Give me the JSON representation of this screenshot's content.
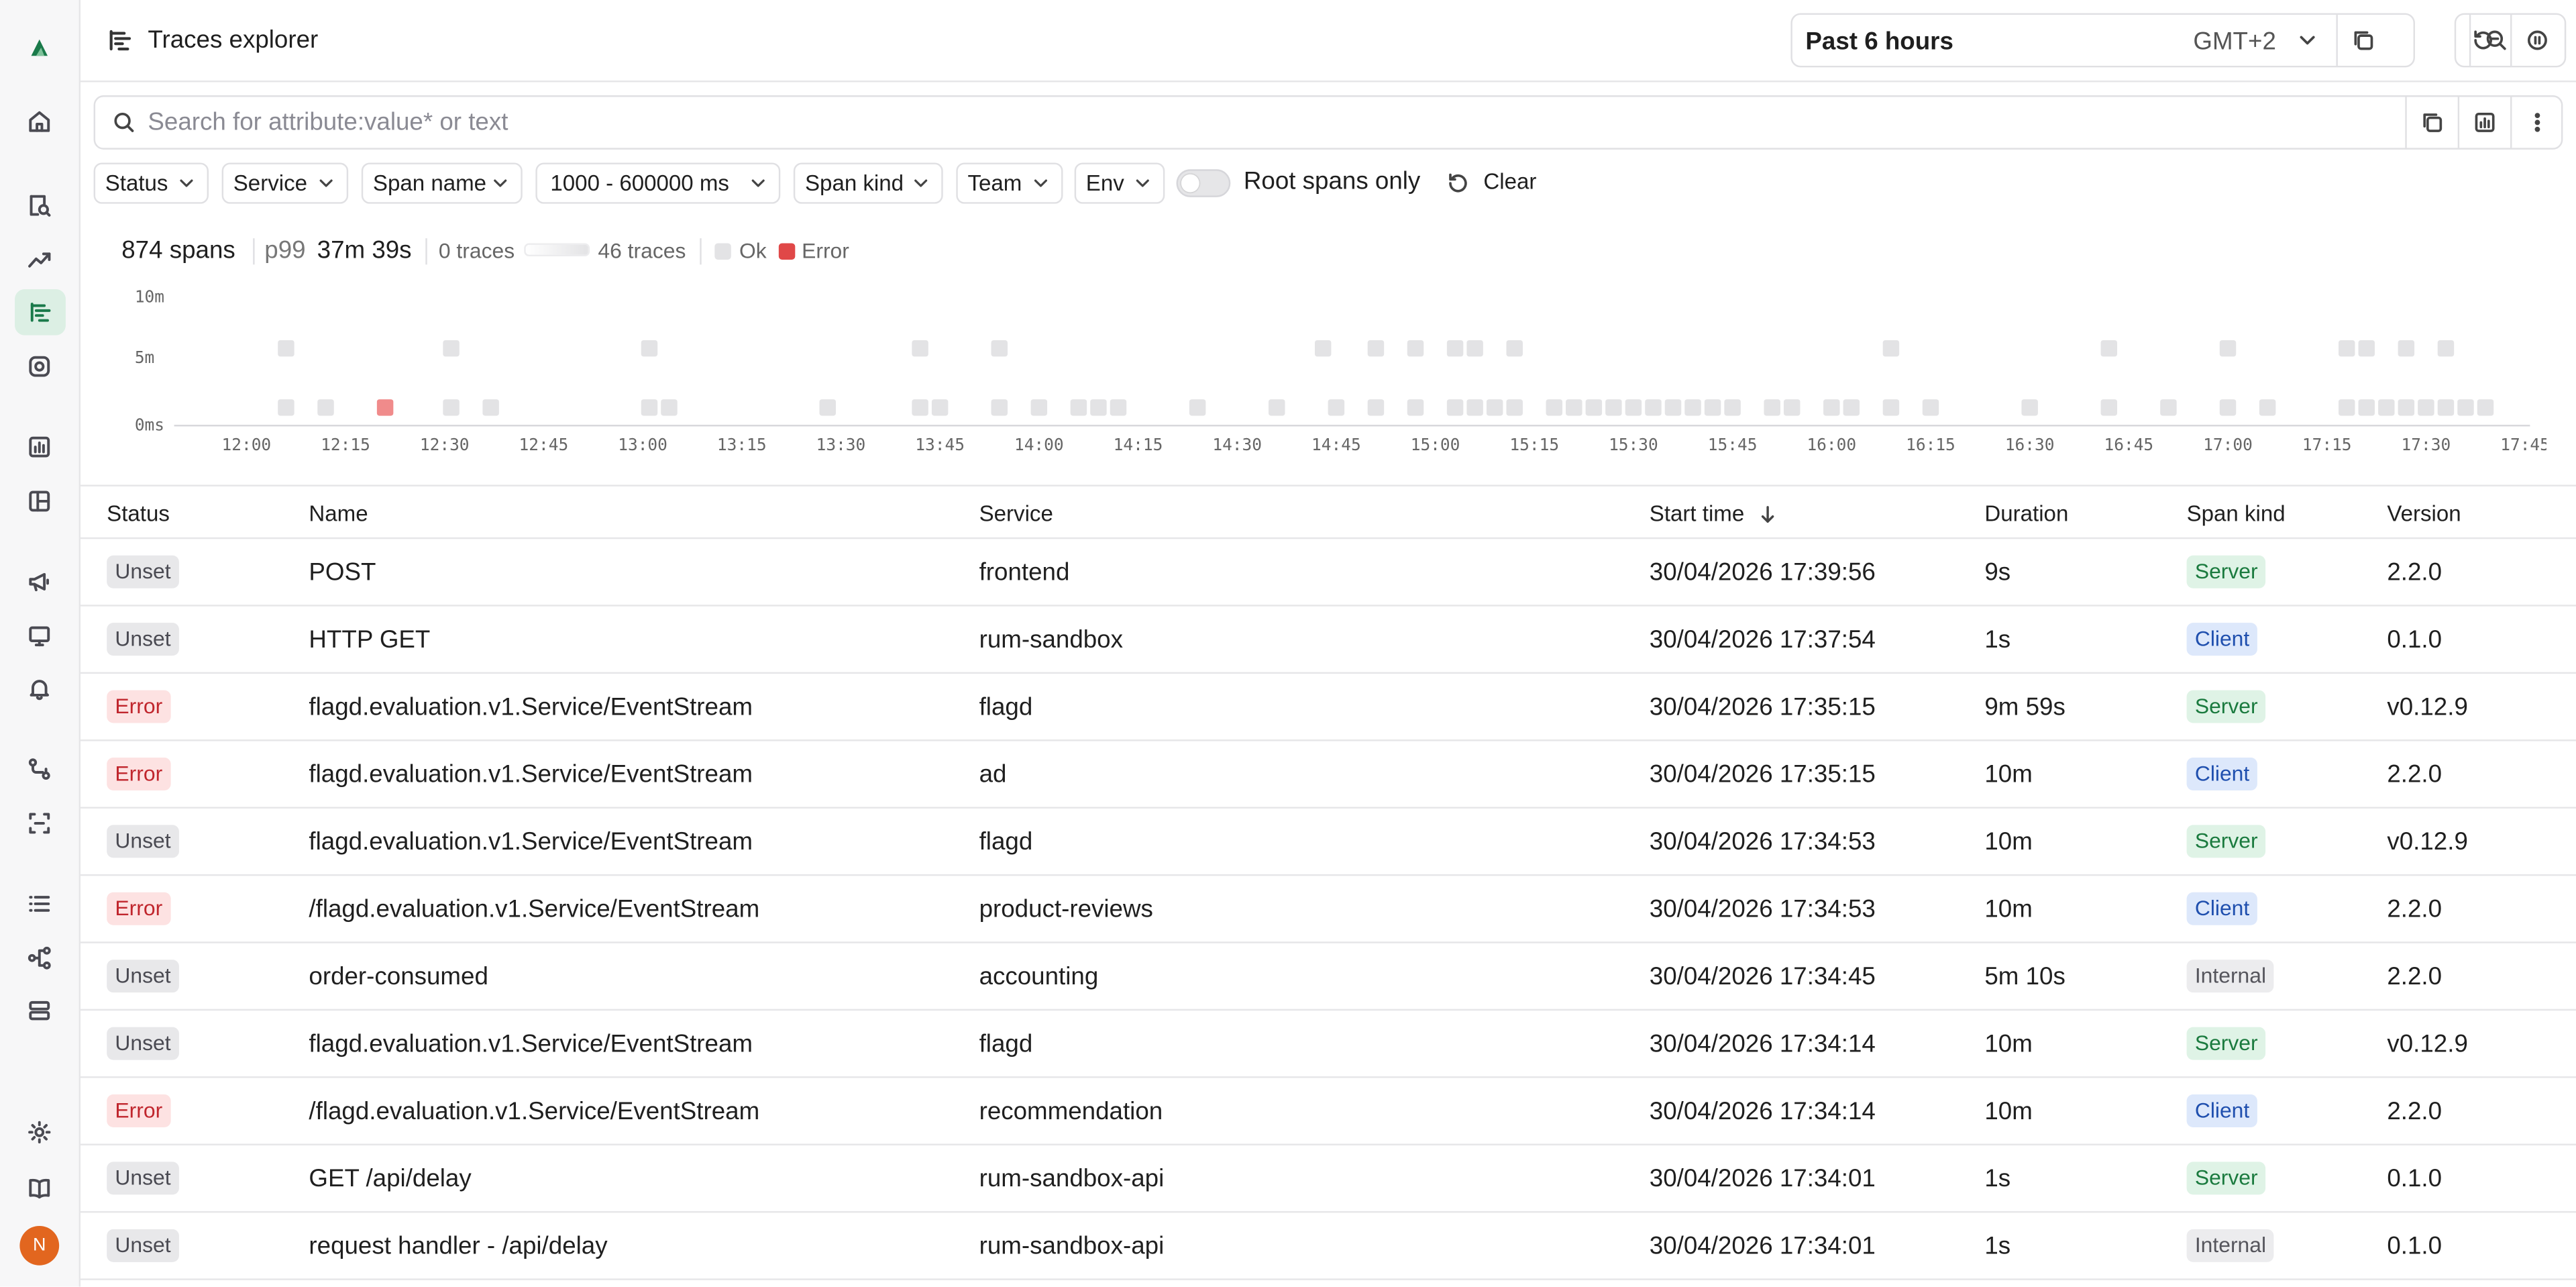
{
  "header": {
    "title": "Traces explorer",
    "time_range": "Past 6 hours",
    "timezone": "GMT+2"
  },
  "search": {
    "placeholder": "Search for attribute:value* or text"
  },
  "filters": [
    "Status",
    "Service",
    "Span name",
    "1000 - 600000 ms",
    "Span kind",
    "Team",
    "Env"
  ],
  "root_spans_only": {
    "label": "Root spans only",
    "enabled": false
  },
  "clear_label": "Clear",
  "stats": {
    "spans": "874 spans",
    "p99_label": "p99",
    "p99_value": "37m 39s",
    "min_traces": "0 traces",
    "max_traces": "46 traces",
    "legend_ok": "Ok",
    "legend_error": "Error"
  },
  "colors": {
    "ok": "#e3e3e5",
    "error": "#f08b8b",
    "accent": "#1a7a4a"
  },
  "chart_data": {
    "type": "heatmap",
    "y_ticks": [
      "10m",
      "5m",
      "0ms"
    ],
    "x_ticks": [
      "12:00",
      "12:15",
      "12:30",
      "12:45",
      "13:00",
      "13:15",
      "13:30",
      "13:45",
      "14:00",
      "14:15",
      "14:30",
      "14:45",
      "15:00",
      "15:15",
      "15:30",
      "15:45",
      "16:00",
      "16:15",
      "16:30",
      "16:45",
      "17:00",
      "17:15",
      "17:30",
      "17:45"
    ],
    "cells": [
      {
        "t": "12:06",
        "row": "5m",
        "status": "Ok"
      },
      {
        "t": "12:31",
        "row": "5m",
        "status": "Ok"
      },
      {
        "t": "13:01",
        "row": "5m",
        "status": "Ok"
      },
      {
        "t": "13:42",
        "row": "5m",
        "status": "Ok"
      },
      {
        "t": "13:54",
        "row": "5m",
        "status": "Ok"
      },
      {
        "t": "14:43",
        "row": "5m",
        "status": "Ok"
      },
      {
        "t": "14:51",
        "row": "5m",
        "status": "Ok"
      },
      {
        "t": "14:57",
        "row": "5m",
        "status": "Ok"
      },
      {
        "t": "15:03",
        "row": "5m",
        "status": "Ok"
      },
      {
        "t": "15:06",
        "row": "5m",
        "status": "Ok"
      },
      {
        "t": "15:12",
        "row": "5m",
        "status": "Ok"
      },
      {
        "t": "16:09",
        "row": "5m",
        "status": "Ok"
      },
      {
        "t": "16:42",
        "row": "5m",
        "status": "Ok"
      },
      {
        "t": "17:00",
        "row": "5m",
        "status": "Ok"
      },
      {
        "t": "17:18",
        "row": "5m",
        "status": "Ok"
      },
      {
        "t": "17:21",
        "row": "5m",
        "status": "Ok"
      },
      {
        "t": "17:27",
        "row": "5m",
        "status": "Ok"
      },
      {
        "t": "17:33",
        "row": "5m",
        "status": "Ok"
      },
      {
        "t": "12:06",
        "row": "0ms",
        "status": "Ok"
      },
      {
        "t": "12:12",
        "row": "0ms",
        "status": "Ok"
      },
      {
        "t": "12:21",
        "row": "0ms",
        "status": "Error"
      },
      {
        "t": "12:31",
        "row": "0ms",
        "status": "Ok"
      },
      {
        "t": "12:37",
        "row": "0ms",
        "status": "Ok"
      },
      {
        "t": "13:01",
        "row": "0ms",
        "status": "Ok"
      },
      {
        "t": "13:04",
        "row": "0ms",
        "status": "Ok"
      },
      {
        "t": "13:28",
        "row": "0ms",
        "status": "Ok"
      },
      {
        "t": "13:42",
        "row": "0ms",
        "status": "Ok"
      },
      {
        "t": "13:45",
        "row": "0ms",
        "status": "Ok"
      },
      {
        "t": "13:54",
        "row": "0ms",
        "status": "Ok"
      },
      {
        "t": "14:00",
        "row": "0ms",
        "status": "Ok"
      },
      {
        "t": "14:06",
        "row": "0ms",
        "status": "Ok"
      },
      {
        "t": "14:09",
        "row": "0ms",
        "status": "Ok"
      },
      {
        "t": "14:12",
        "row": "0ms",
        "status": "Ok"
      },
      {
        "t": "14:24",
        "row": "0ms",
        "status": "Ok"
      },
      {
        "t": "14:36",
        "row": "0ms",
        "status": "Ok"
      },
      {
        "t": "14:45",
        "row": "0ms",
        "status": "Ok"
      },
      {
        "t": "14:51",
        "row": "0ms",
        "status": "Ok"
      },
      {
        "t": "14:57",
        "row": "0ms",
        "status": "Ok"
      },
      {
        "t": "15:03",
        "row": "0ms",
        "status": "Ok"
      },
      {
        "t": "15:06",
        "row": "0ms",
        "status": "Ok"
      },
      {
        "t": "15:09",
        "row": "0ms",
        "status": "Ok"
      },
      {
        "t": "15:12",
        "row": "0ms",
        "status": "Ok"
      },
      {
        "t": "15:18",
        "row": "0ms",
        "status": "Ok"
      },
      {
        "t": "15:21",
        "row": "0ms",
        "status": "Ok"
      },
      {
        "t": "15:24",
        "row": "0ms",
        "status": "Ok"
      },
      {
        "t": "15:27",
        "row": "0ms",
        "status": "Ok"
      },
      {
        "t": "15:30",
        "row": "0ms",
        "status": "Ok"
      },
      {
        "t": "15:33",
        "row": "0ms",
        "status": "Ok"
      },
      {
        "t": "15:36",
        "row": "0ms",
        "status": "Ok"
      },
      {
        "t": "15:39",
        "row": "0ms",
        "status": "Ok"
      },
      {
        "t": "15:42",
        "row": "0ms",
        "status": "Ok"
      },
      {
        "t": "15:45",
        "row": "0ms",
        "status": "Ok"
      },
      {
        "t": "15:51",
        "row": "0ms",
        "status": "Ok"
      },
      {
        "t": "15:54",
        "row": "0ms",
        "status": "Ok"
      },
      {
        "t": "16:00",
        "row": "0ms",
        "status": "Ok"
      },
      {
        "t": "16:03",
        "row": "0ms",
        "status": "Ok"
      },
      {
        "t": "16:09",
        "row": "0ms",
        "status": "Ok"
      },
      {
        "t": "16:15",
        "row": "0ms",
        "status": "Ok"
      },
      {
        "t": "16:30",
        "row": "0ms",
        "status": "Ok"
      },
      {
        "t": "16:42",
        "row": "0ms",
        "status": "Ok"
      },
      {
        "t": "16:51",
        "row": "0ms",
        "status": "Ok"
      },
      {
        "t": "17:00",
        "row": "0ms",
        "status": "Ok"
      },
      {
        "t": "17:06",
        "row": "0ms",
        "status": "Ok"
      },
      {
        "t": "17:18",
        "row": "0ms",
        "status": "Ok"
      },
      {
        "t": "17:21",
        "row": "0ms",
        "status": "Ok"
      },
      {
        "t": "17:24",
        "row": "0ms",
        "status": "Ok"
      },
      {
        "t": "17:27",
        "row": "0ms",
        "status": "Ok"
      },
      {
        "t": "17:30",
        "row": "0ms",
        "status": "Ok"
      },
      {
        "t": "17:33",
        "row": "0ms",
        "status": "Ok"
      },
      {
        "t": "17:36",
        "row": "0ms",
        "status": "Ok"
      },
      {
        "t": "17:39",
        "row": "0ms",
        "status": "Ok"
      }
    ]
  },
  "table": {
    "columns": [
      "Status",
      "Name",
      "Service",
      "Start time",
      "Duration",
      "Span kind",
      "Version"
    ],
    "sort_column": "Start time",
    "sort_direction": "desc",
    "rows": [
      {
        "status": "Unset",
        "name": "POST",
        "service": "frontend",
        "start": "30/04/2026 17:39:56",
        "duration": "9s",
        "kind": "Server",
        "version": "2.2.0"
      },
      {
        "status": "Unset",
        "name": "HTTP GET",
        "service": "rum-sandbox",
        "start": "30/04/2026 17:37:54",
        "duration": "1s",
        "kind": "Client",
        "version": "0.1.0"
      },
      {
        "status": "Error",
        "name": "flagd.evaluation.v1.Service/EventStream",
        "service": "flagd",
        "start": "30/04/2026 17:35:15",
        "duration": "9m 59s",
        "kind": "Server",
        "version": "v0.12.9"
      },
      {
        "status": "Error",
        "name": "flagd.evaluation.v1.Service/EventStream",
        "service": "ad",
        "start": "30/04/2026 17:35:15",
        "duration": "10m",
        "kind": "Client",
        "version": "2.2.0"
      },
      {
        "status": "Unset",
        "name": "flagd.evaluation.v1.Service/EventStream",
        "service": "flagd",
        "start": "30/04/2026 17:34:53",
        "duration": "10m",
        "kind": "Server",
        "version": "v0.12.9"
      },
      {
        "status": "Error",
        "name": "/flagd.evaluation.v1.Service/EventStream",
        "service": "product-reviews",
        "start": "30/04/2026 17:34:53",
        "duration": "10m",
        "kind": "Client",
        "version": "2.2.0"
      },
      {
        "status": "Unset",
        "name": "order-consumed",
        "service": "accounting",
        "start": "30/04/2026 17:34:45",
        "duration": "5m 10s",
        "kind": "Internal",
        "version": "2.2.0"
      },
      {
        "status": "Unset",
        "name": "flagd.evaluation.v1.Service/EventStream",
        "service": "flagd",
        "start": "30/04/2026 17:34:14",
        "duration": "10m",
        "kind": "Server",
        "version": "v0.12.9"
      },
      {
        "status": "Error",
        "name": "/flagd.evaluation.v1.Service/EventStream",
        "service": "recommendation",
        "start": "30/04/2026 17:34:14",
        "duration": "10m",
        "kind": "Client",
        "version": "2.2.0"
      },
      {
        "status": "Unset",
        "name": "GET /api/delay",
        "service": "rum-sandbox-api",
        "start": "30/04/2026 17:34:01",
        "duration": "1s",
        "kind": "Server",
        "version": "0.1.0"
      },
      {
        "status": "Unset",
        "name": "request handler - /api/delay",
        "service": "rum-sandbox-api",
        "start": "30/04/2026 17:34:01",
        "duration": "1s",
        "kind": "Internal",
        "version": "0.1.0"
      }
    ]
  },
  "sidebar_user_initial": "N"
}
